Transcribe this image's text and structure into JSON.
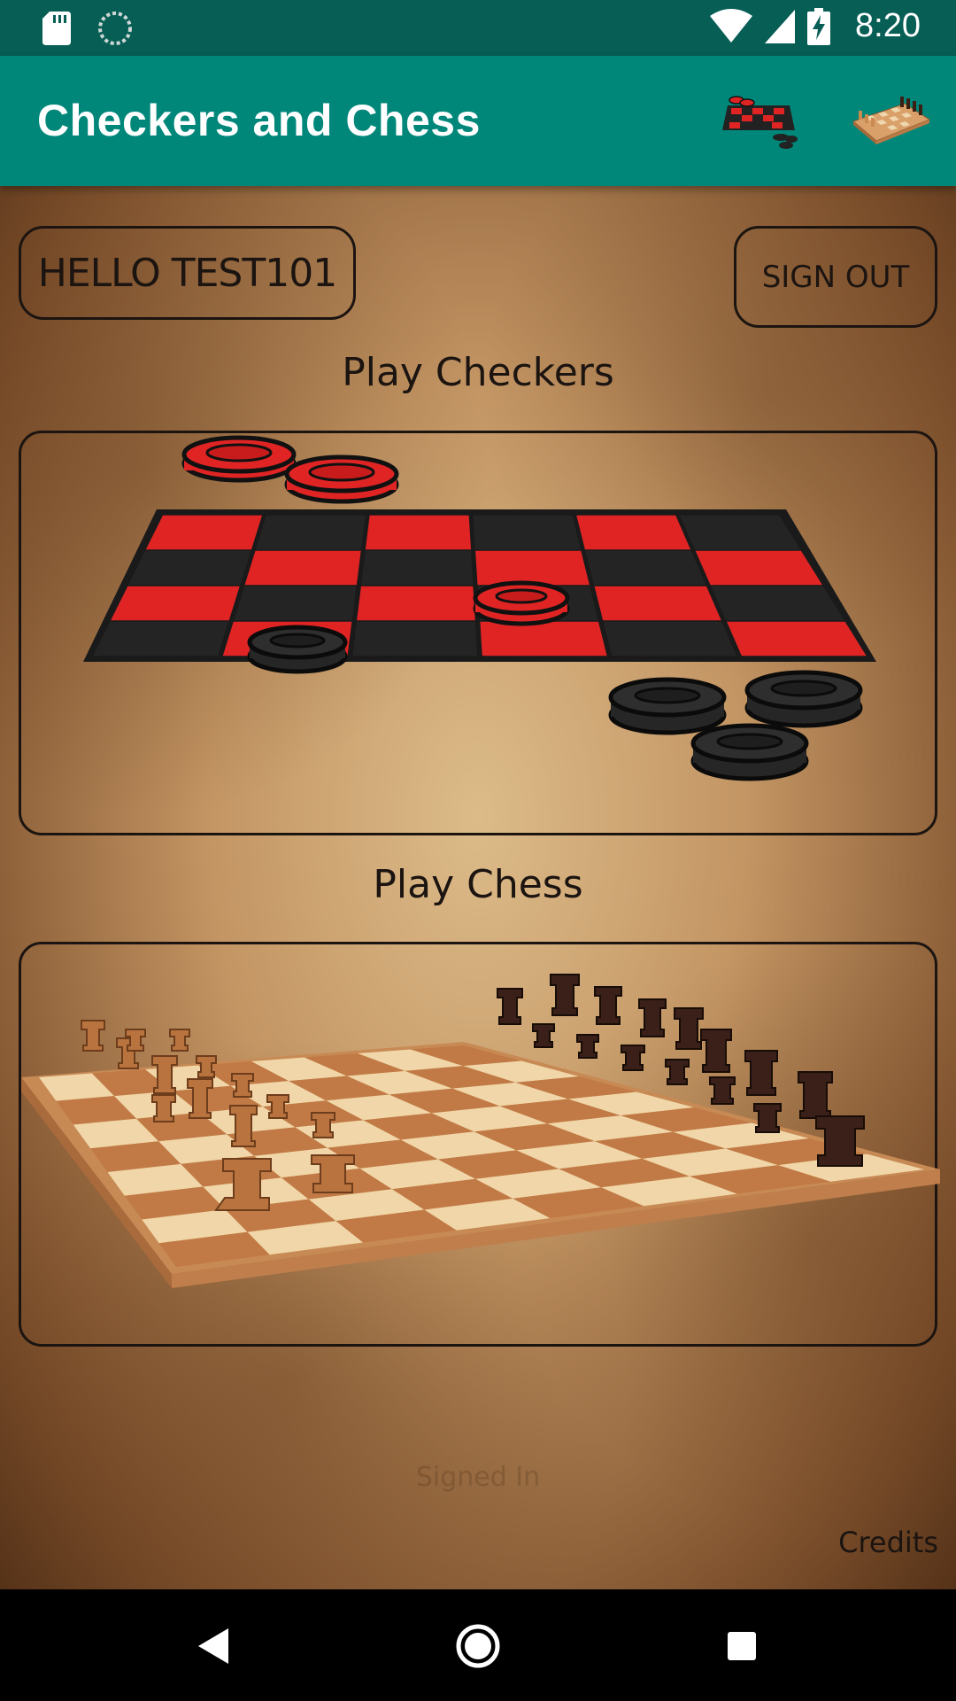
{
  "status_bar": {
    "time": "8:20",
    "icons": [
      "sd-card-icon",
      "sync-icon",
      "wifi-icon",
      "signal-icon",
      "battery-charging-icon"
    ]
  },
  "app_bar": {
    "title": "Checkers and Chess",
    "actions": [
      "checkers-board-icon",
      "chess-board-icon"
    ]
  },
  "main": {
    "greeting_button": "HELLO TEST101",
    "signout_button": "SIGN OUT",
    "checkers_label": "Play Checkers",
    "chess_label": "Play Chess",
    "faint_status": "Signed In",
    "credits_link": "Credits"
  },
  "nav_bar": {
    "buttons": [
      "back-icon",
      "home-icon",
      "recents-icon"
    ]
  },
  "colors": {
    "status_bar": "#075e55",
    "app_bar": "#00877a",
    "checker_red": "#e02424",
    "checker_black": "#242424",
    "outline": "#1b1410"
  }
}
